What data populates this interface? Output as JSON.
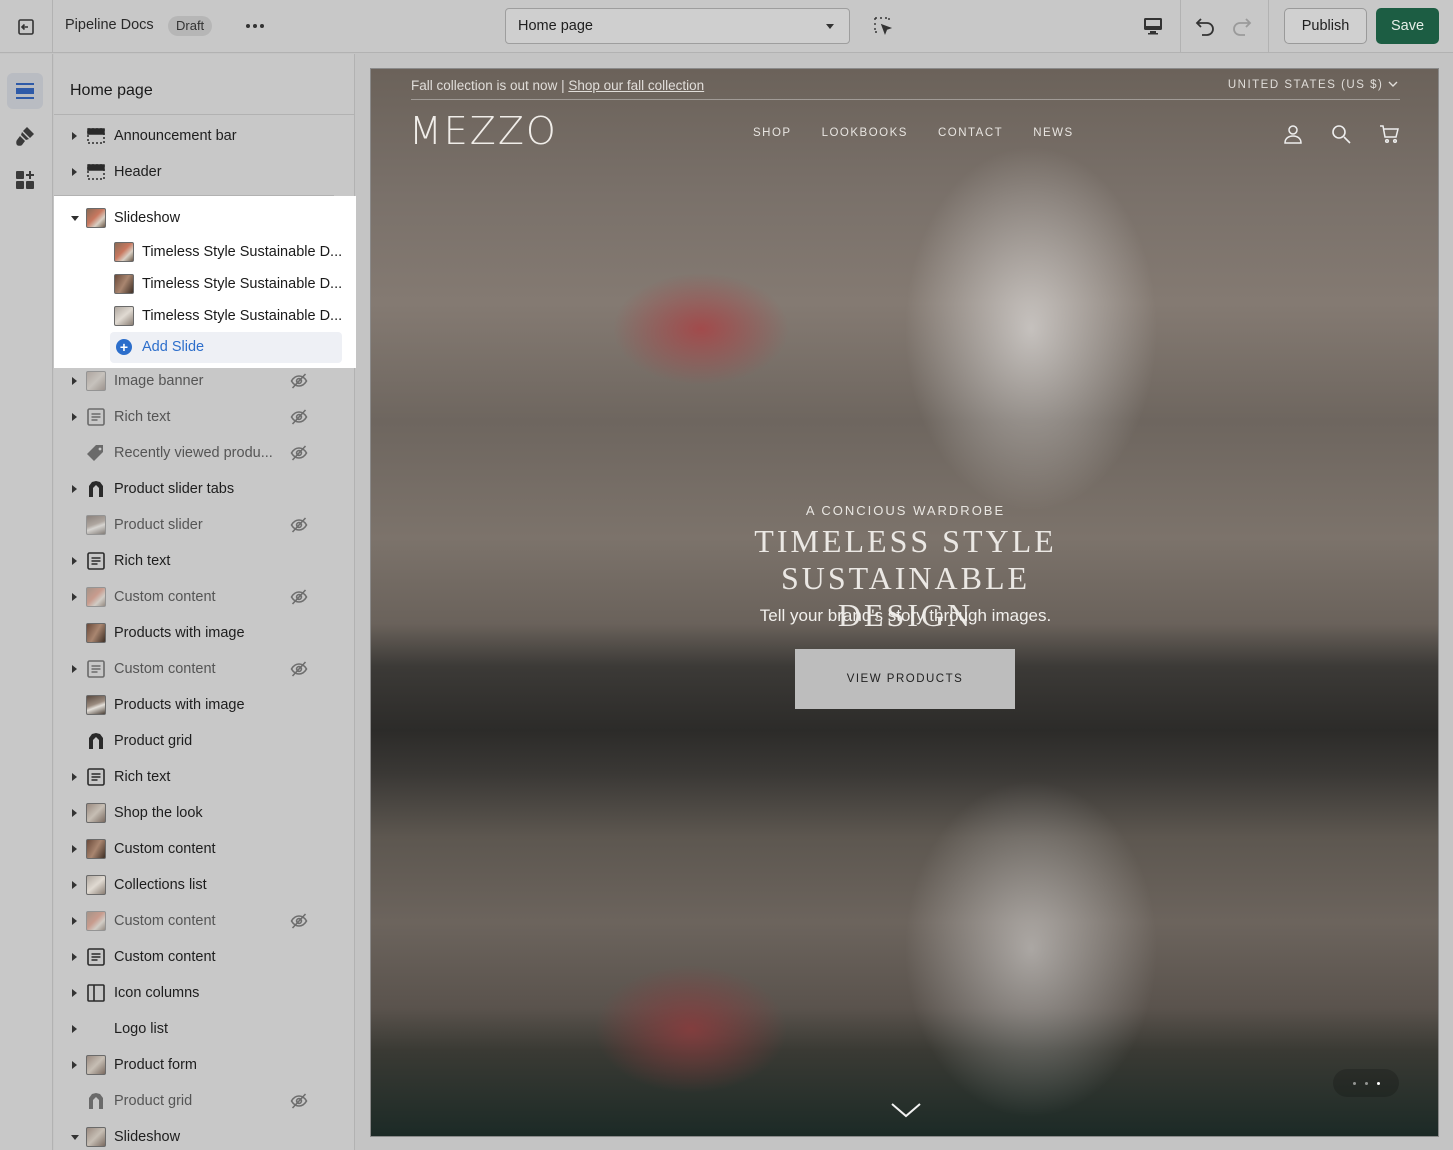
{
  "topbar": {
    "store_name": "Pipeline Docs",
    "status_badge": "Draft",
    "page_select": "Home page",
    "publish_label": "Publish",
    "save_label": "Save"
  },
  "sidebar": {
    "title": "Home page",
    "items": [
      {
        "label": "Announcement bar",
        "icon": "layout-bar-icon",
        "hidden": false,
        "has_children": true
      },
      {
        "label": "Header",
        "icon": "layout-header-icon",
        "hidden": false,
        "has_children": true
      },
      {
        "label": "Slideshow",
        "icon": "image-thumbnail",
        "hidden": false,
        "expanded": true,
        "blocks": [
          {
            "label": "Timeless Style Sustainable D..."
          },
          {
            "label": "Timeless Style Sustainable D..."
          },
          {
            "label": "Timeless Style Sustainable D..."
          }
        ],
        "add_label": "Add Slide"
      },
      {
        "label": "Image banner",
        "icon": "image-thumbnail",
        "hidden": true,
        "has_children": true
      },
      {
        "label": "Rich text",
        "icon": "text-block-icon",
        "hidden": true,
        "has_children": true
      },
      {
        "label": "Recently viewed produ...",
        "icon": "tag-icon",
        "hidden": true,
        "has_children": false
      },
      {
        "label": "Product slider tabs",
        "icon": "product-bag-icon",
        "hidden": false,
        "has_children": true
      },
      {
        "label": "Product slider",
        "icon": "image-thumbnail",
        "hidden": true,
        "has_children": false
      },
      {
        "label": "Rich text",
        "icon": "text-block-icon",
        "hidden": false,
        "has_children": true
      },
      {
        "label": "Custom content",
        "icon": "image-thumbnail",
        "hidden": true,
        "has_children": true
      },
      {
        "label": "Products with image",
        "icon": "image-thumbnail",
        "hidden": false,
        "has_children": false
      },
      {
        "label": "Custom content",
        "icon": "text-block-icon",
        "hidden": true,
        "has_children": true
      },
      {
        "label": "Products with image",
        "icon": "image-thumbnail",
        "hidden": false,
        "has_children": false
      },
      {
        "label": "Product grid",
        "icon": "product-bag-icon",
        "hidden": false,
        "has_children": false
      },
      {
        "label": "Rich text",
        "icon": "text-block-icon",
        "hidden": false,
        "has_children": true
      },
      {
        "label": "Shop the look",
        "icon": "image-thumbnail",
        "hidden": false,
        "has_children": true
      },
      {
        "label": "Custom content",
        "icon": "image-thumbnail",
        "hidden": false,
        "has_children": true
      },
      {
        "label": "Collections list",
        "icon": "image-thumbnail",
        "hidden": false,
        "has_children": true
      },
      {
        "label": "Custom content",
        "icon": "image-thumbnail",
        "hidden": true,
        "has_children": true
      },
      {
        "label": "Custom content",
        "icon": "text-block-icon",
        "hidden": false,
        "has_children": true
      },
      {
        "label": "Icon columns",
        "icon": "columns-icon",
        "hidden": false,
        "has_children": true
      },
      {
        "label": "Logo list",
        "icon": "none",
        "hidden": false,
        "has_children": true
      },
      {
        "label": "Product form",
        "icon": "image-thumbnail",
        "hidden": false,
        "has_children": true
      },
      {
        "label": "Product grid",
        "icon": "product-bag-icon",
        "hidden": true,
        "has_children": false
      },
      {
        "label": "Slideshow",
        "icon": "image-thumbnail",
        "hidden": false,
        "has_children": true,
        "expanded": true
      }
    ]
  },
  "preview": {
    "announcement_text": "Fall collection is out now | ",
    "announcement_link": "Shop our fall collection",
    "country": "UNITED STATES (US $)",
    "logo": "MEZZO",
    "nav": [
      "SHOP",
      "LOOKBOOKS",
      "CONTACT",
      "NEWS"
    ],
    "kicker": "A CONCIOUS WARDROBE",
    "heading_line1": "TIMELESS STYLE SUSTAINABLE",
    "heading_line2": "DESIGN",
    "subheading": "Tell your brand's story through images.",
    "button_label": "VIEW PRODUCTS",
    "slide_count": 3,
    "active_slide": 3
  },
  "colors": {
    "save_button": "#1c5d43",
    "link_blue": "#2c6ecb",
    "overlay_gray": "#c8c8c8"
  }
}
